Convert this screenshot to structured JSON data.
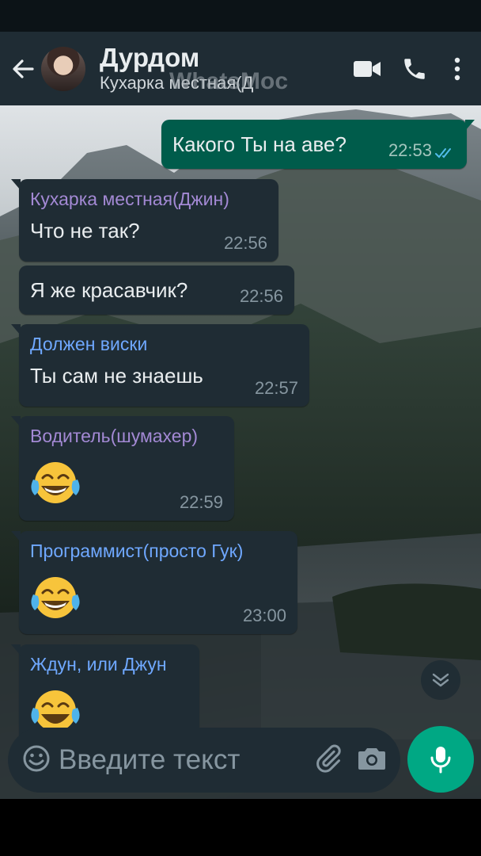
{
  "header": {
    "title": "Дурдом",
    "subtitle": "Кухарка местная(Д",
    "watermark": "WhatsMock"
  },
  "messages": [
    {
      "type": "outgoing",
      "text": "Какого Ты на аве?",
      "time": "22:53"
    },
    {
      "type": "incoming",
      "sender": "Кухарка местная(Джин)",
      "sender_color": "#a389d4",
      "text": "Что не так?",
      "time": "22:56"
    },
    {
      "type": "incoming",
      "text": "Я же красавчик?",
      "time": "22:56"
    },
    {
      "type": "incoming",
      "sender": "Должен виски",
      "sender_color": "#6fa8ff",
      "text": "Ты сам не знаешь",
      "time": "22:57"
    },
    {
      "type": "incoming",
      "sender": "Водитель(шумахер)",
      "sender_color": "#a389d4",
      "emoji": "face-with-tears-of-joy",
      "time": "22:59"
    },
    {
      "type": "incoming",
      "sender": "Программист(просто Гук)",
      "sender_color": "#6fa8ff",
      "emoji": "face-with-tears-of-joy",
      "time": "23:00"
    },
    {
      "type": "incoming",
      "sender": "Ждун, или Джун",
      "sender_color": "#6fa8ff",
      "emoji": "face-with-tears-of-joy"
    }
  ],
  "input": {
    "placeholder": "Введите текст"
  },
  "colors": {
    "header_bg": "#1f2c34",
    "incoming_bubble": "#1f2c34",
    "outgoing_bubble": "#005c4b",
    "accent": "#00a884"
  }
}
